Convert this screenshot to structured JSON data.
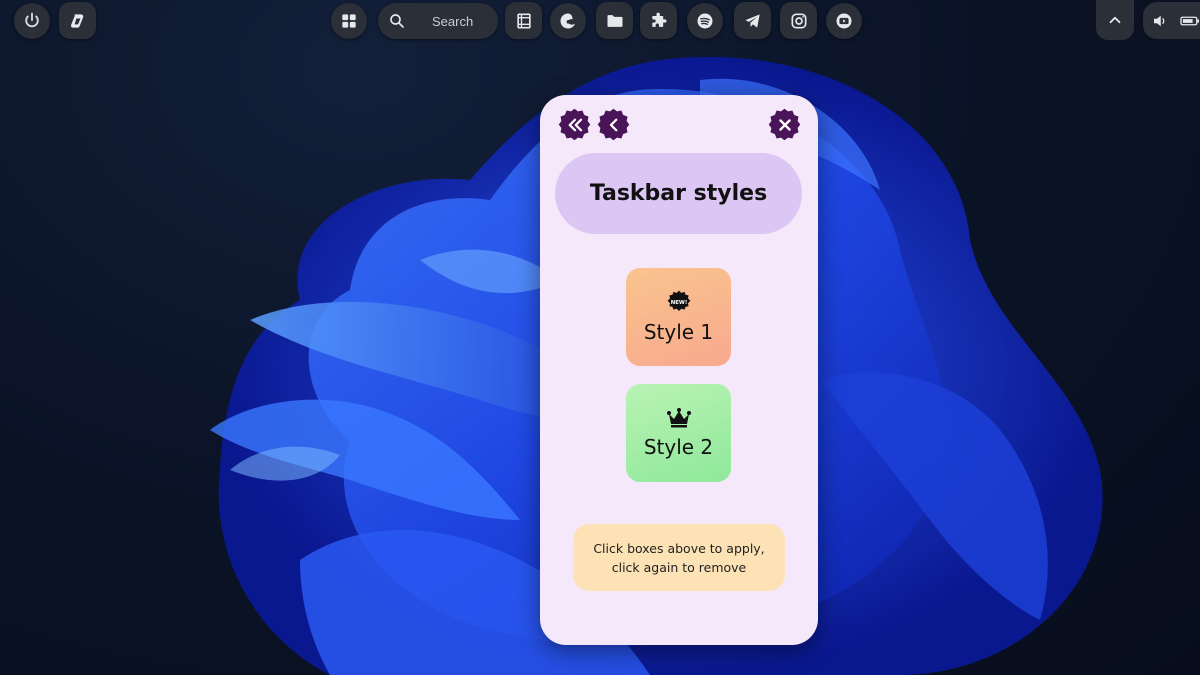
{
  "taskbar": {
    "search_placeholder": "Search",
    "left_buttons": [
      "power-icon",
      "copilot-icon"
    ],
    "center_apps": [
      "windows-start-icon",
      "search-icon",
      "media-icon",
      "edge-icon",
      "file-explorer-icon",
      "extensions-icon",
      "spotify-icon",
      "telegram-icon",
      "instagram-icon",
      "youtube-icon"
    ],
    "tray": [
      "chevron-up-icon",
      "volume-icon",
      "battery-icon"
    ]
  },
  "panel": {
    "title": "Taskbar styles",
    "nav": [
      "double-chevron-left-icon",
      "chevron-left-icon",
      "close-icon"
    ],
    "styles": [
      {
        "label": "Style 1",
        "badge": "NEW!",
        "icon": "new-badge-icon",
        "color": "#f9b98e"
      },
      {
        "label": "Style 2",
        "icon": "crown-icon",
        "color": "#a5eea8"
      }
    ],
    "hint": "Click boxes above to apply,\nclick again to remove"
  },
  "colors": {
    "panel_bg": "#f6e8fb",
    "title_pill": "#dcc6f3",
    "accent": "#4a1458",
    "hint_bg": "#fde2b6",
    "taskbar_button": "#2a2f38"
  }
}
